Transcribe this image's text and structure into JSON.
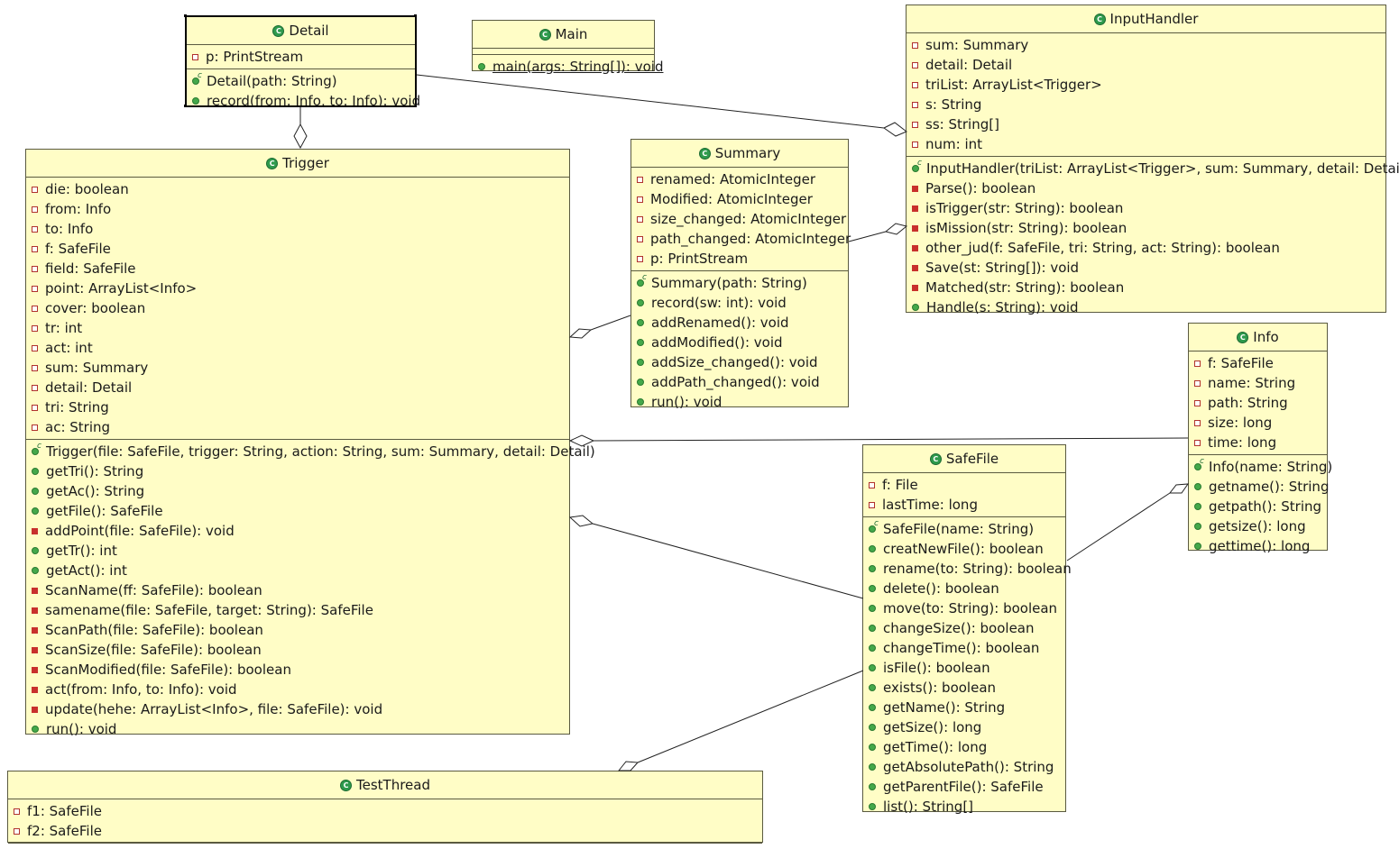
{
  "classes": {
    "detail": {
      "name": "Detail",
      "fields": [
        {
          "vis": "priv-f",
          "text": "p: PrintStream"
        }
      ],
      "methods": [
        {
          "vis": "ctor",
          "text": "Detail(path: String)"
        },
        {
          "vis": "pub",
          "text": "record(from: Info, to: Info): void"
        }
      ]
    },
    "main": {
      "name": "Main",
      "fields": [],
      "methods": [
        {
          "vis": "pub",
          "text": "main(args: String[]): void",
          "static": true
        }
      ]
    },
    "inputhandler": {
      "name": "InputHandler",
      "fields": [
        {
          "vis": "priv-f",
          "text": "sum: Summary"
        },
        {
          "vis": "priv-f",
          "text": "detail: Detail"
        },
        {
          "vis": "priv-f",
          "text": "triList: ArrayList<Trigger>"
        },
        {
          "vis": "priv-f",
          "text": "s: String"
        },
        {
          "vis": "priv-f",
          "text": "ss: String[]"
        },
        {
          "vis": "priv-f",
          "text": "num: int"
        }
      ],
      "methods": [
        {
          "vis": "ctor",
          "text": "InputHandler(triList: ArrayList<Trigger>, sum: Summary, detail: Detail)"
        },
        {
          "vis": "priv-m",
          "text": "Parse(): boolean"
        },
        {
          "vis": "priv-m",
          "text": "isTrigger(str: String): boolean"
        },
        {
          "vis": "priv-m",
          "text": "isMission(str: String): boolean"
        },
        {
          "vis": "priv-m",
          "text": "other_jud(f: SafeFile, tri: String, act: String): boolean"
        },
        {
          "vis": "priv-m",
          "text": "Save(st: String[]): void"
        },
        {
          "vis": "priv-m",
          "text": "Matched(str: String): boolean"
        },
        {
          "vis": "pub",
          "text": "Handle(s: String): void"
        }
      ]
    },
    "trigger": {
      "name": "Trigger",
      "fields": [
        {
          "vis": "priv-f",
          "text": "die: boolean"
        },
        {
          "vis": "priv-f",
          "text": "from: Info"
        },
        {
          "vis": "priv-f",
          "text": "to: Info"
        },
        {
          "vis": "priv-f",
          "text": "f: SafeFile"
        },
        {
          "vis": "priv-f",
          "text": "field: SafeFile"
        },
        {
          "vis": "priv-f",
          "text": "point: ArrayList<Info>"
        },
        {
          "vis": "priv-f",
          "text": "cover: boolean"
        },
        {
          "vis": "priv-f",
          "text": "tr: int"
        },
        {
          "vis": "priv-f",
          "text": "act: int"
        },
        {
          "vis": "priv-f",
          "text": "sum: Summary"
        },
        {
          "vis": "priv-f",
          "text": "detail: Detail"
        },
        {
          "vis": "priv-f",
          "text": "tri: String"
        },
        {
          "vis": "priv-f",
          "text": "ac: String"
        }
      ],
      "methods": [
        {
          "vis": "ctor",
          "text": "Trigger(file: SafeFile, trigger: String, action: String, sum: Summary, detail: Detail)"
        },
        {
          "vis": "pub",
          "text": "getTri(): String"
        },
        {
          "vis": "pub",
          "text": "getAc(): String"
        },
        {
          "vis": "pub",
          "text": "getFile(): SafeFile"
        },
        {
          "vis": "priv-m",
          "text": "addPoint(file: SafeFile): void"
        },
        {
          "vis": "pub",
          "text": "getTr(): int"
        },
        {
          "vis": "pub",
          "text": "getAct(): int"
        },
        {
          "vis": "priv-m",
          "text": "ScanName(ff: SafeFile): boolean"
        },
        {
          "vis": "priv-m",
          "text": "samename(file: SafeFile, target: String): SafeFile"
        },
        {
          "vis": "priv-m",
          "text": "ScanPath(file: SafeFile): boolean"
        },
        {
          "vis": "priv-m",
          "text": "ScanSize(file: SafeFile): boolean"
        },
        {
          "vis": "priv-m",
          "text": "ScanModified(file: SafeFile): boolean"
        },
        {
          "vis": "priv-m",
          "text": "act(from: Info, to: Info): void"
        },
        {
          "vis": "priv-m",
          "text": "update(hehe: ArrayList<Info>, file: SafeFile): void"
        },
        {
          "vis": "pub",
          "text": "run(): void"
        }
      ]
    },
    "summary": {
      "name": "Summary",
      "fields": [
        {
          "vis": "priv-f",
          "text": "renamed: AtomicInteger"
        },
        {
          "vis": "priv-f",
          "text": "Modified: AtomicInteger"
        },
        {
          "vis": "priv-f",
          "text": "size_changed: AtomicInteger"
        },
        {
          "vis": "priv-f",
          "text": "path_changed: AtomicInteger"
        },
        {
          "vis": "priv-f",
          "text": "p: PrintStream"
        }
      ],
      "methods": [
        {
          "vis": "ctor",
          "text": "Summary(path: String)"
        },
        {
          "vis": "pub",
          "text": "record(sw: int): void"
        },
        {
          "vis": "pub",
          "text": "addRenamed(): void"
        },
        {
          "vis": "pub",
          "text": "addModified(): void"
        },
        {
          "vis": "pub",
          "text": "addSize_changed(): void"
        },
        {
          "vis": "pub",
          "text": "addPath_changed(): void"
        },
        {
          "vis": "pub",
          "text": "run(): void"
        }
      ]
    },
    "info": {
      "name": "Info",
      "fields": [
        {
          "vis": "priv-f",
          "text": "f: SafeFile"
        },
        {
          "vis": "priv-f",
          "text": "name: String"
        },
        {
          "vis": "priv-f",
          "text": "path: String"
        },
        {
          "vis": "priv-f",
          "text": "size: long"
        },
        {
          "vis": "priv-f",
          "text": "time: long"
        }
      ],
      "methods": [
        {
          "vis": "ctor",
          "text": "Info(name: String)"
        },
        {
          "vis": "pub",
          "text": "getname(): String"
        },
        {
          "vis": "pub",
          "text": "getpath(): String"
        },
        {
          "vis": "pub",
          "text": "getsize(): long"
        },
        {
          "vis": "pub",
          "text": "gettime(): long"
        }
      ]
    },
    "safefile": {
      "name": "SafeFile",
      "fields": [
        {
          "vis": "priv-f",
          "text": "f: File"
        },
        {
          "vis": "priv-f",
          "text": "lastTime: long"
        }
      ],
      "methods": [
        {
          "vis": "ctor",
          "text": "SafeFile(name: String)"
        },
        {
          "vis": "pub",
          "text": "creatNewFile(): boolean"
        },
        {
          "vis": "pub",
          "text": "rename(to: String): boolean"
        },
        {
          "vis": "pub",
          "text": "delete(): boolean"
        },
        {
          "vis": "pub",
          "text": "move(to: String): boolean"
        },
        {
          "vis": "pub",
          "text": "changeSize(): boolean"
        },
        {
          "vis": "pub",
          "text": "changeTime(): boolean"
        },
        {
          "vis": "pub",
          "text": "isFile(): boolean"
        },
        {
          "vis": "pub",
          "text": "exists(): boolean"
        },
        {
          "vis": "pub",
          "text": "getName(): String"
        },
        {
          "vis": "pub",
          "text": "getSize(): long"
        },
        {
          "vis": "pub",
          "text": "getTime(): long"
        },
        {
          "vis": "pub",
          "text": "getAbsolutePath(): String"
        },
        {
          "vis": "pub",
          "text": "getParentFile(): SafeFile"
        },
        {
          "vis": "pub",
          "text": "list(): String[]"
        }
      ]
    },
    "testthread": {
      "name": "TestThread",
      "fields": [
        {
          "vis": "priv-f",
          "text": "f1: SafeFile"
        },
        {
          "vis": "priv-f",
          "text": "f2: SafeFile"
        }
      ],
      "methods": []
    }
  }
}
